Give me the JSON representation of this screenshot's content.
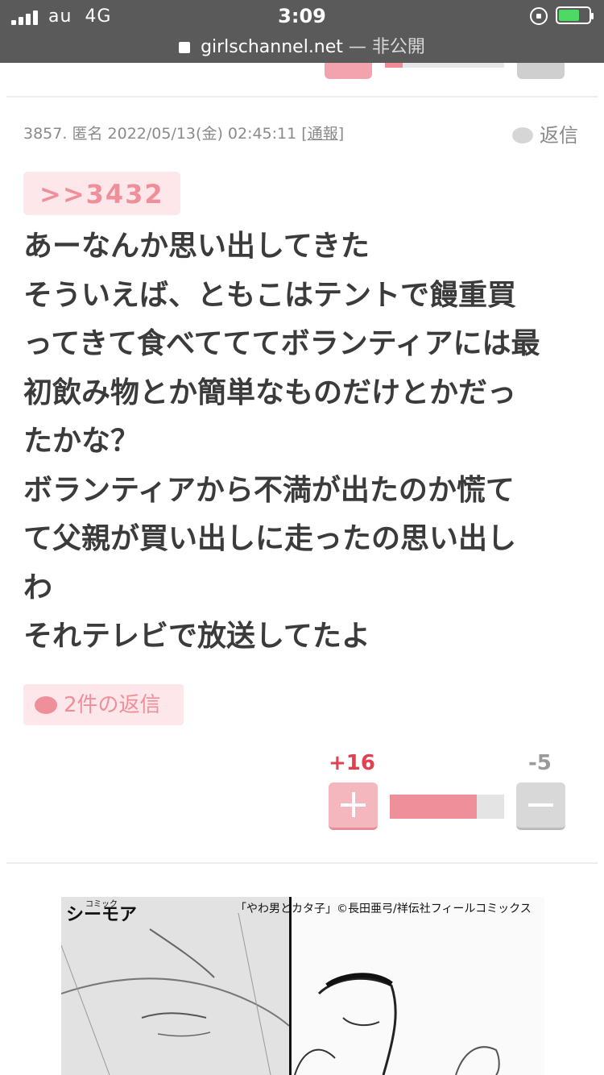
{
  "status": {
    "carrier": "au",
    "network": "4G",
    "time": "3:09"
  },
  "address": {
    "domain": "girlschannel.net",
    "suffix": "— 非公開"
  },
  "comment": {
    "number": "3857.",
    "author": "匿名",
    "datetime": "2022/05/13(金) 02:45:11",
    "report_label": "通報",
    "reply_label": "返信",
    "anchor": ">>3432",
    "lines": [
      "あーなんか思い出してきた",
      "そういえば、ともこはテントで饅重買",
      "ってきて食べてててボランティアには最",
      "初飲み物とか簡単なものだけとかだっ",
      "たかな？",
      "ボランティアから不満が出たのか慌て",
      "て父親が買い出しに走ったの思い出し",
      "わ",
      "それテレビで放送してたよ"
    ],
    "replies_button": "2件の返信",
    "plus_votes": "+16",
    "minus_votes": "-5",
    "plus_ratio": 0.76
  },
  "ad": {
    "logo": "シーモア",
    "logo_small": "コミック",
    "credit": "「やわ男とカタ子」©長田亜弓/祥伝社フィールコミックス"
  }
}
